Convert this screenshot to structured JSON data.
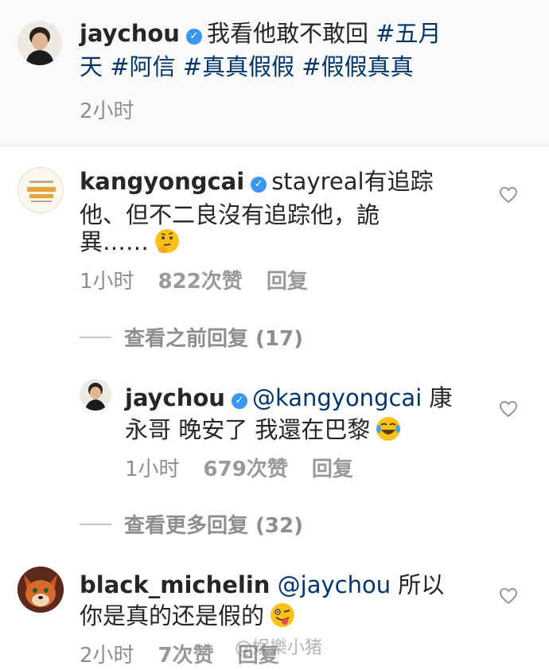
{
  "caption": {
    "username": "jaychou",
    "text_line1": "我看他敢不敢回 ",
    "tag1": "#五月",
    "tag1b": "天",
    "tag2": "#阿信",
    "tag3": "#真真假假",
    "tag4": "#假假真真",
    "time": "2小时"
  },
  "comments": [
    {
      "username": "kangyongcai",
      "line1": "stayreal有追踪",
      "line2": "他、但不二良沒有追踪他，詭",
      "line3": "異……",
      "time": "1小时",
      "likes": "822次赞",
      "reply": "回复",
      "view_replies": "查看之前回复 (17)"
    },
    {
      "username": "jaychou",
      "mention": "@kangyongcai",
      "line1_rest": " 康",
      "line2": "永哥 晚安了 我還在巴黎",
      "time": "1小时",
      "likes": "679次赞",
      "reply": "回复",
      "view_replies": "查看更多回复 (32)"
    },
    {
      "username": "black_michelin",
      "mention": "@jaychou",
      "line1_rest": " 所以",
      "line2": "你是真的还是假的",
      "time": "2小时",
      "likes": "7次赞",
      "reply": "回复"
    }
  ],
  "watermark": "@娱樂小猪",
  "colors": {
    "verified": "#3897f0",
    "hashtag": "#003569",
    "meta": "#8e8e8e"
  },
  "icons": [
    "verified-badge-icon",
    "heart-icon",
    "thinking-face-emoji",
    "tears-of-joy-emoji",
    "winking-tongue-emoji"
  ]
}
